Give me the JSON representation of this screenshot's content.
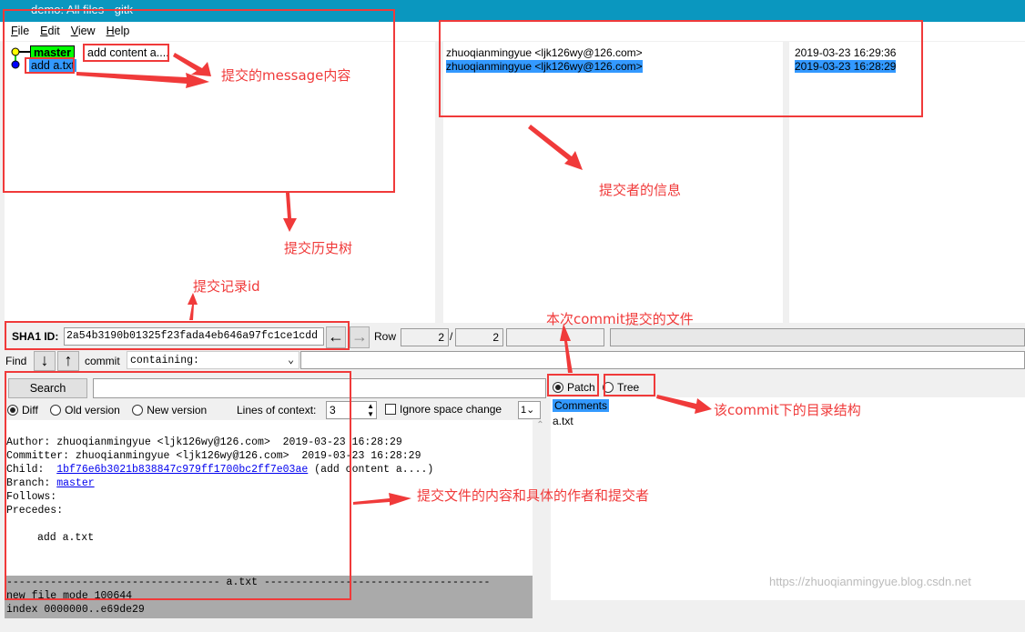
{
  "window": {
    "title": "demo: All files - gitk"
  },
  "menu": [
    "File",
    "Edit",
    "View",
    "Help"
  ],
  "history": {
    "commits": [
      {
        "branch": "master",
        "message": "add content a...."
      },
      {
        "message": "add a.txt"
      }
    ]
  },
  "authors": [
    "zhuoqianmingyue <ljk126wy@126.com>",
    "zhuoqianmingyue <ljk126wy@126.com>"
  ],
  "dates": [
    "2019-03-23 16:29:36",
    "2019-03-23 16:28:29"
  ],
  "sha": {
    "label": "SHA1 ID:",
    "value": "2a54b3190b01325f23fada4eb646a97fc1ce1cdd",
    "row_label": "Row",
    "row_current": "2",
    "row_sep": "/",
    "row_total": "2"
  },
  "find": {
    "label": "Find",
    "type": "commit",
    "mode": "containing:"
  },
  "search": {
    "button": "Search"
  },
  "diffopts": {
    "diff": "Diff",
    "old": "Old version",
    "new": "New version",
    "context_label": "Lines of context:",
    "context_value": "3",
    "ignore": "Ignore space change",
    "extra": "1"
  },
  "patchtree": {
    "patch": "Patch",
    "tree": "Tree"
  },
  "files": [
    "Comments",
    "a.txt"
  ],
  "details": {
    "author": "Author: zhuoqianmingyue <ljk126wy@126.com>  2019-03-23 16:28:29",
    "committer": "Committer: zhuoqianmingyue <ljk126wy@126.com>  2019-03-23 16:28:29",
    "child_label": "Child:  ",
    "child_sha": "1bf76e6b3021b838847c979ff1700bc2ff7e03ae",
    "child_msg": " (add content a....)",
    "branch_label": "Branch: ",
    "branch": "master",
    "follows": "Follows:",
    "precedes": "Precedes:",
    "message": "add a.txt",
    "file_header": "---------------------------------- a.txt ------------------------------------",
    "mode": "new file mode 100644",
    "index": "index 0000000..e69de29"
  },
  "annotations": {
    "message": "提交的message内容",
    "author": "提交者的信息",
    "tree": "提交历史树",
    "id": "提交记录id",
    "files": "本次commit提交的文件",
    "dir": "该commit下的目录结构",
    "content": "提交文件的内容和具体的作者和提交者"
  },
  "watermark": "https://zhuoqianmingyue.blog.csdn.net",
  "colors": {
    "titlebar": "#0a97bf",
    "branch": "#00ff00",
    "selected": "#3399ff",
    "annotation": "#f03a3a"
  }
}
